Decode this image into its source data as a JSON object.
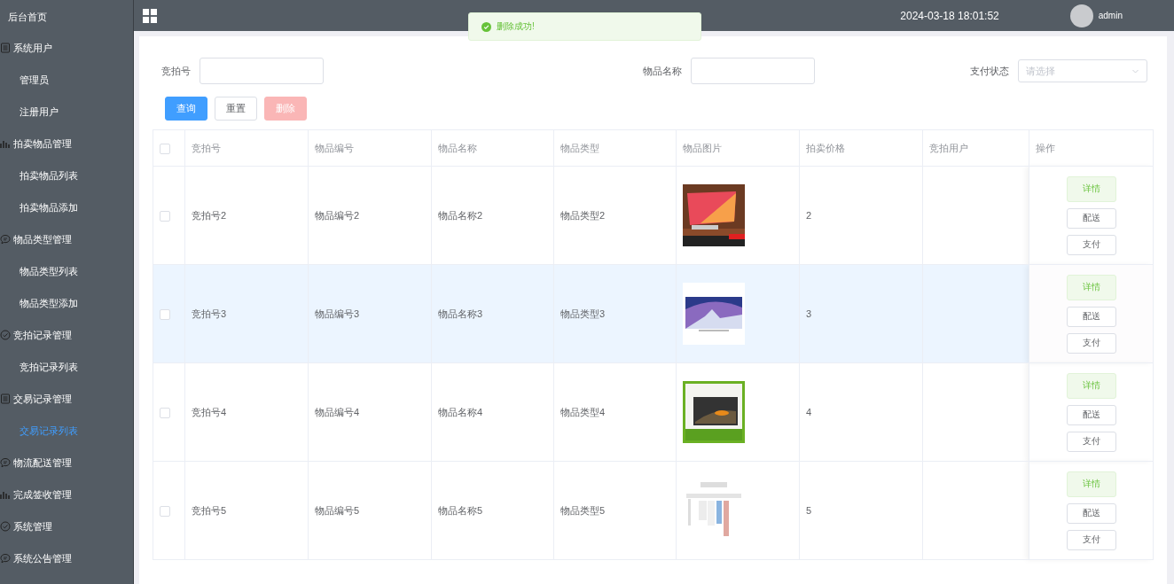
{
  "sidebar": {
    "home": "后台首页",
    "groups": [
      {
        "label": "系统用户",
        "kind": "list",
        "children": [
          {
            "label": "管理员",
            "selected": false
          },
          {
            "label": "注册用户",
            "selected": false
          }
        ]
      },
      {
        "label": "拍卖物品管理",
        "kind": "chart",
        "children": [
          {
            "label": "拍卖物品列表",
            "selected": false
          },
          {
            "label": "拍卖物品添加",
            "selected": false
          }
        ]
      },
      {
        "label": "物品类型管理",
        "kind": "chat",
        "children": [
          {
            "label": "物品类型列表",
            "selected": false
          },
          {
            "label": "物品类型添加",
            "selected": false
          }
        ]
      },
      {
        "label": "竞拍记录管理",
        "kind": "check",
        "children": [
          {
            "label": "竞拍记录列表",
            "selected": false
          }
        ]
      },
      {
        "label": "交易记录管理",
        "kind": "list",
        "children": [
          {
            "label": "交易记录列表",
            "selected": true
          }
        ]
      },
      {
        "label": "物流配送管理",
        "kind": "chat"
      },
      {
        "label": "完成签收管理",
        "kind": "chart"
      },
      {
        "label": "系统管理",
        "kind": "check"
      },
      {
        "label": "系统公告管理",
        "kind": "chat"
      }
    ]
  },
  "header": {
    "datetime": "2024-03-18 18:01:52",
    "user": "admin"
  },
  "toast": {
    "message": "删除成功!"
  },
  "search": {
    "fields": [
      {
        "label": "竞拍号",
        "kind": "input"
      },
      {
        "label": "物品名称",
        "kind": "input"
      },
      {
        "label": "支付状态",
        "kind": "select",
        "placeholder": "请选择"
      }
    ],
    "buttons": [
      {
        "label": "查询",
        "kind": "primary"
      },
      {
        "label": "重置",
        "kind": "default"
      },
      {
        "label": "删除",
        "kind": "danger"
      }
    ]
  },
  "table": {
    "all_checked": false,
    "columns": [
      "竞拍号",
      "物品编号",
      "物品名称",
      "物品类型",
      "物品图片",
      "拍卖价格",
      "竞拍用户",
      "操作"
    ],
    "rows": [
      {
        "checked": false,
        "highlighted": false,
        "cells": [
          "竞拍号2",
          "物品编号2",
          "物品名称2",
          "物品类型2"
        ],
        "image": {
          "kind": "picture"
        },
        "price": "2",
        "actions": [
          "详情",
          "配送",
          "支付"
        ]
      },
      {
        "checked": false,
        "highlighted": true,
        "cells": [
          "竞拍号3",
          "物品编号3",
          "物品名称3",
          "物品类型3"
        ],
        "image": {
          "kind": "picture"
        },
        "price": "3",
        "actions": [
          "详情",
          "配送",
          "支付"
        ]
      },
      {
        "checked": false,
        "highlighted": false,
        "cells": [
          "竞拍号4",
          "物品编号4",
          "物品名称4",
          "物品类型4"
        ],
        "image": {
          "kind": "picture"
        },
        "price": "4",
        "actions": [
          "详情",
          "配送",
          "支付"
        ]
      },
      {
        "checked": false,
        "highlighted": false,
        "cells": [
          "竞拍号5",
          "物品编号5",
          "物品名称5",
          "物品类型5"
        ],
        "image": {
          "kind": "picture"
        },
        "price": "5",
        "actions": [
          "详情",
          "配送",
          "支付"
        ]
      }
    ]
  }
}
